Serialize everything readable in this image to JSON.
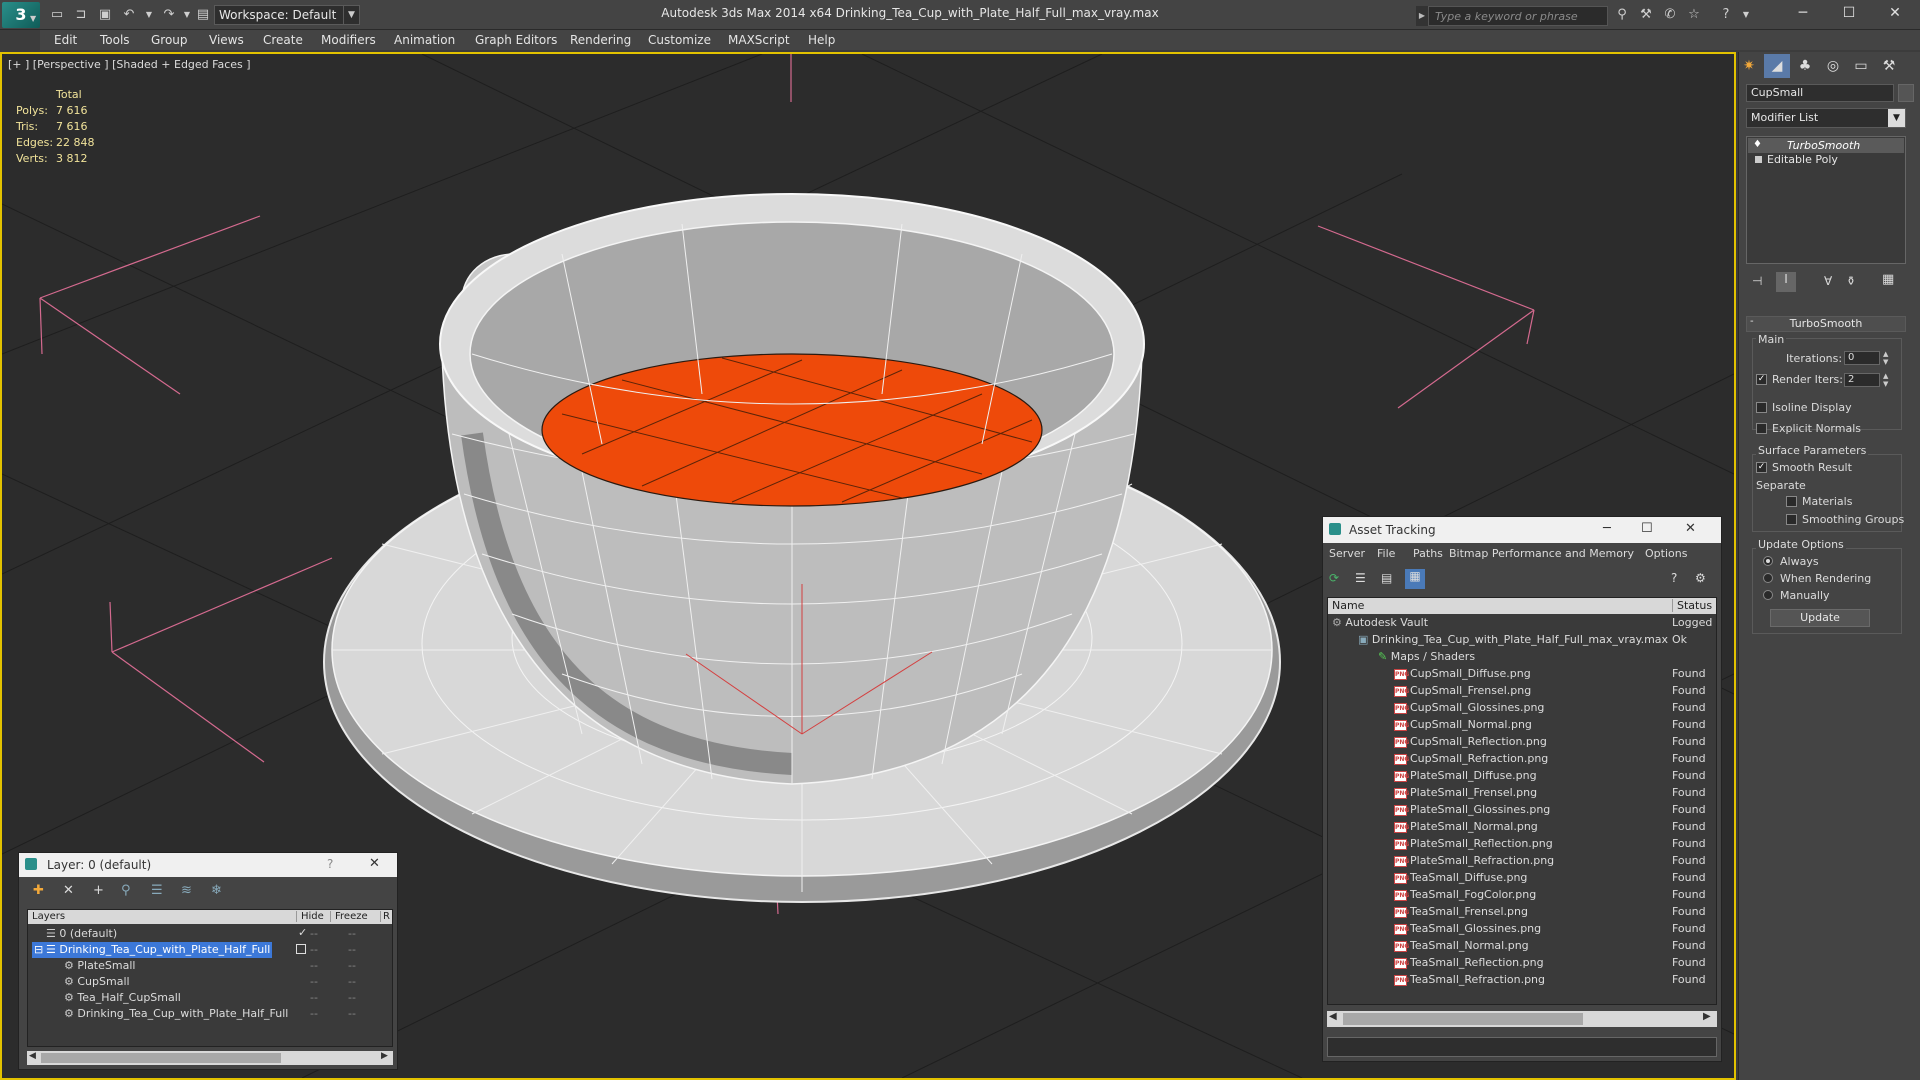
{
  "title_bar": {
    "workspace": "Workspace: Default",
    "window_title": "Autodesk 3ds Max  2014 x64      Drinking_Tea_Cup_with_Plate_Half_Full_max_vray.max",
    "search_placeholder": "Type a keyword or phrase"
  },
  "menu": [
    "Edit",
    "Tools",
    "Group",
    "Views",
    "Create",
    "Modifiers",
    "Animation",
    "Graph Editors",
    "Rendering",
    "Customize",
    "MAXScript",
    "Help"
  ],
  "viewport": {
    "label": "[+ ] [Perspective ] [Shaded + Edged Faces ]",
    "stats": {
      "header": "Total",
      "rows": [
        {
          "label": "Polys:",
          "value": "7 616"
        },
        {
          "label": "Tris:",
          "value": "7 616"
        },
        {
          "label": "Edges:",
          "value": "22 848"
        },
        {
          "label": "Verts:",
          "value": "3 812"
        }
      ]
    },
    "colors": {
      "tea": "#ee4a0a",
      "grid_lines": "#e07aa0",
      "border": "#e2c200"
    }
  },
  "command_panel": {
    "object_name": "CupSmall",
    "modifier_list": "Modifier List",
    "stack": [
      "TurboSmooth",
      "Editable Poly"
    ],
    "turbosmooth": {
      "title": "TurboSmooth",
      "main": "Main",
      "iterations_label": "Iterations:",
      "iterations": "0",
      "render_iters_label": "Render Iters:",
      "render_iters": "2",
      "isoline": "Isoline Display",
      "explicit_normals": "Explicit Normals",
      "surface_params": "Surface Parameters",
      "smooth_result": "Smooth Result",
      "separate": "Separate",
      "materials": "Materials",
      "smoothing_groups": "Smoothing Groups",
      "update_options": "Update Options",
      "always": "Always",
      "when_rendering": "When Rendering",
      "manually": "Manually",
      "update_btn": "Update"
    }
  },
  "asset_tracking": {
    "title": "Asset Tracking",
    "menu": [
      "Server",
      "File",
      "Paths",
      "Bitmap Performance and Memory",
      "Options"
    ],
    "col_name": "Name",
    "col_status": "Status",
    "rows": [
      {
        "name": "Autodesk Vault",
        "status": "Logged"
      },
      {
        "name": "Drinking_Tea_Cup_with_Plate_Half_Full_max_vray.max",
        "status": "Ok"
      },
      {
        "name": "Maps / Shaders",
        "status": ""
      },
      {
        "name": "CupSmall_Diffuse.png",
        "status": "Found"
      },
      {
        "name": "CupSmall_Frensel.png",
        "status": "Found"
      },
      {
        "name": "CupSmall_Glossines.png",
        "status": "Found"
      },
      {
        "name": "CupSmall_Normal.png",
        "status": "Found"
      },
      {
        "name": "CupSmall_Reflection.png",
        "status": "Found"
      },
      {
        "name": "CupSmall_Refraction.png",
        "status": "Found"
      },
      {
        "name": "PlateSmall_Diffuse.png",
        "status": "Found"
      },
      {
        "name": "PlateSmall_Frensel.png",
        "status": "Found"
      },
      {
        "name": "PlateSmall_Glossines.png",
        "status": "Found"
      },
      {
        "name": "PlateSmall_Normal.png",
        "status": "Found"
      },
      {
        "name": "PlateSmall_Reflection.png",
        "status": "Found"
      },
      {
        "name": "PlateSmall_Refraction.png",
        "status": "Found"
      },
      {
        "name": "TeaSmall_Diffuse.png",
        "status": "Found"
      },
      {
        "name": "TeaSmall_FogColor.png",
        "status": "Found"
      },
      {
        "name": "TeaSmall_Frensel.png",
        "status": "Found"
      },
      {
        "name": "TeaSmall_Glossines.png",
        "status": "Found"
      },
      {
        "name": "TeaSmall_Normal.png",
        "status": "Found"
      },
      {
        "name": "TeaSmall_Reflection.png",
        "status": "Found"
      },
      {
        "name": "TeaSmall_Refraction.png",
        "status": "Found"
      }
    ]
  },
  "layer_panel": {
    "title": "Layer: 0 (default)",
    "help": "?",
    "col_layers": "Layers",
    "col_hide": "Hide",
    "col_freeze": "Freeze",
    "col_r": "R",
    "rows": [
      {
        "name": "0 (default)"
      },
      {
        "name": "Drinking_Tea_Cup_with_Plate_Half_Full"
      },
      {
        "name": "PlateSmall"
      },
      {
        "name": "CupSmall"
      },
      {
        "name": "Tea_Half_CupSmall"
      },
      {
        "name": "Drinking_Tea_Cup_with_Plate_Half_Full"
      }
    ]
  }
}
